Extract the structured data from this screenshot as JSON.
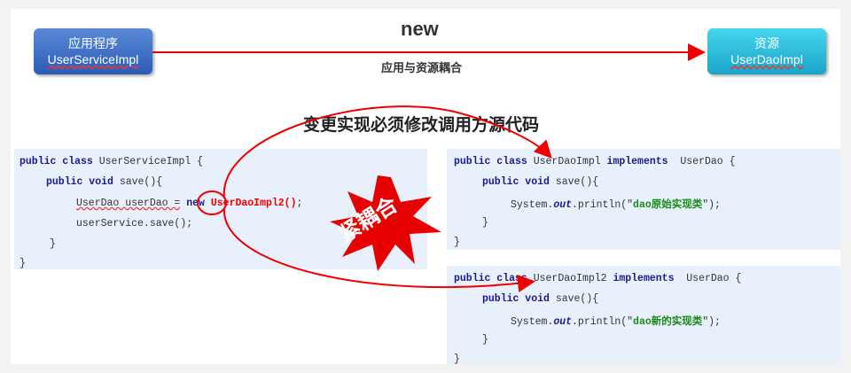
{
  "left_box": {
    "title": "应用程序",
    "subtitle": "UserServiceImpl"
  },
  "right_box": {
    "title": "资源",
    "subtitle": "UserDaoImpl"
  },
  "arrow_label": "new",
  "coupling_label": "应用与资源耦合",
  "heading": "变更实现必须修改调用方源代码",
  "burst_label": "紧耦合",
  "code_a": {
    "l1_kw": "public class",
    "l1_rest": " UserServiceImpl {",
    "l2_kw": "public void",
    "l2_rest": " save(){",
    "l3_a": "UserDao userDao =",
    "l3_new": "new",
    "l3_cls": "UserDaoImpl2()",
    "l3_end": ";",
    "l4": "userService.save();",
    "l5": "}",
    "l6": "}"
  },
  "code_b": {
    "l1_kw": "public class",
    "l1_cls": " UserDaoImpl ",
    "l1_impl": "implements",
    "l1_rest": "  UserDao {",
    "l2_kw": "public void",
    "l2_rest": " save(){",
    "l3_a": "System.",
    "l3_out": "out",
    "l3_b": ".println(\"",
    "l3_str": "dao原始实现类",
    "l3_c": "\");",
    "l4": "}",
    "l5": "}"
  },
  "code_c": {
    "l1_kw": "public class",
    "l1_cls": " UserDaoImpl2 ",
    "l1_impl": "implements",
    "l1_rest": "  UserDao {",
    "l2_kw": "public void",
    "l2_rest": " save(){",
    "l3_a": "System.",
    "l3_out": "out",
    "l3_b": ".println(\"",
    "l3_str": "dao新的实现类",
    "l3_c": "\");",
    "l4": "}",
    "l5": "}"
  }
}
